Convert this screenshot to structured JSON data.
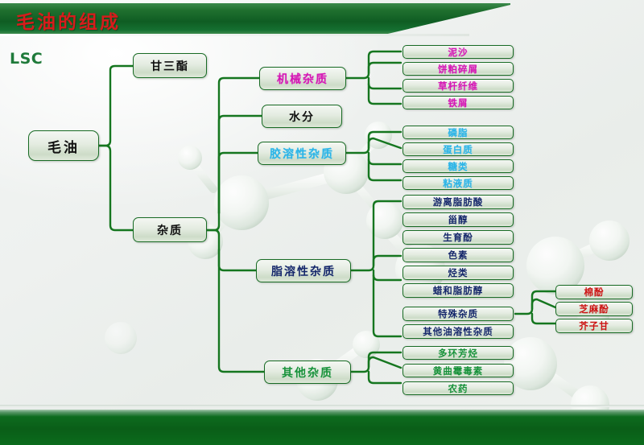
{
  "header": {
    "title": "毛油的组成"
  },
  "logo": {
    "text": "LSC"
  },
  "colors": {
    "header_green": "#0f5d23",
    "title_red": "#d61c1c",
    "node_border": "#186b24",
    "magenta": "#d517b5",
    "cyan": "#29b4e8",
    "navy": "#15276b",
    "green": "#17923a",
    "red": "#cc1111",
    "black": "#111111"
  },
  "root": {
    "label": "毛油"
  },
  "level1": [
    {
      "label": "甘三酯",
      "color": "black"
    },
    {
      "label": "杂质",
      "color": "black"
    }
  ],
  "level2": [
    {
      "label": "机械杂质",
      "color": "magenta"
    },
    {
      "label": "水分",
      "color": "black"
    },
    {
      "label": "胶溶性杂质",
      "color": "cyan"
    },
    {
      "label": "脂溶性杂质",
      "color": "navy"
    },
    {
      "label": "其他杂质",
      "color": "green"
    }
  ],
  "groups": {
    "mechanical": [
      {
        "label": "泥沙",
        "color": "magenta"
      },
      {
        "label": "饼粕碎屑",
        "color": "magenta"
      },
      {
        "label": "草杆纤维",
        "color": "magenta"
      },
      {
        "label": "铁屑",
        "color": "magenta"
      }
    ],
    "colloidal": [
      {
        "label": "磷脂",
        "color": "cyan"
      },
      {
        "label": "蛋白质",
        "color": "cyan"
      },
      {
        "label": "糖类",
        "color": "cyan"
      },
      {
        "label": "粘液质",
        "color": "cyan"
      }
    ],
    "liposoluble": [
      {
        "label": "游离脂肪酸",
        "color": "navy"
      },
      {
        "label": "甾醇",
        "color": "navy"
      },
      {
        "label": "生育酚",
        "color": "navy"
      },
      {
        "label": "色素",
        "color": "navy"
      },
      {
        "label": "烃类",
        "color": "navy"
      },
      {
        "label": "蜡和脂肪醇",
        "color": "navy"
      },
      {
        "label": "特殊杂质",
        "color": "navy"
      },
      {
        "label": "其他油溶性杂质",
        "color": "navy"
      }
    ],
    "special": [
      {
        "label": "棉酚",
        "color": "red"
      },
      {
        "label": "芝麻酚",
        "color": "red"
      },
      {
        "label": "芥子甘",
        "color": "red"
      }
    ],
    "other": [
      {
        "label": "多环芳烃",
        "color": "green"
      },
      {
        "label": "黄曲霉毒素",
        "color": "green"
      },
      {
        "label": "农药",
        "color": "green"
      }
    ]
  }
}
